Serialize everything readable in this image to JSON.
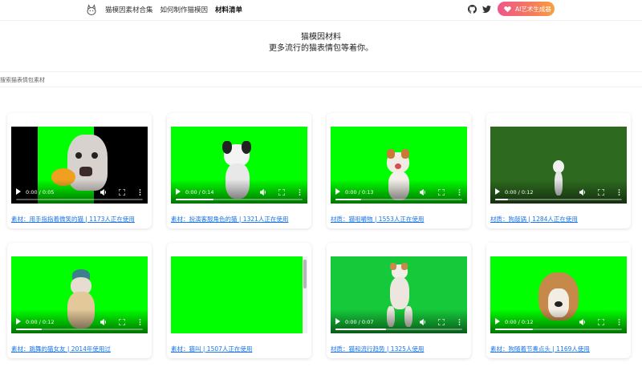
{
  "header": {
    "nav": [
      "猫模因素材合集",
      "如何制作猫模因",
      "材料清单"
    ],
    "active_index": 2,
    "ai_button": "AI艺术生成器",
    "icons": [
      "github-icon",
      "twitter-icon"
    ]
  },
  "hero": {
    "title": "猫模因材料",
    "subtitle": "更多流行的猫表情包等着你。"
  },
  "search": {
    "placeholder": "搜索猫表情包素材"
  },
  "cards": [
    {
      "time": "0:00 / 0:05",
      "caption": "素材：用手指指着微笑的猫 | 1173人正在使用",
      "progress": 0.0
    },
    {
      "time": "0:00 / 0:14",
      "caption": "素材：扮演客服角色的猫 | 1321人正在使用",
      "progress": 0.3
    },
    {
      "time": "0:00 / 0:13",
      "caption": "材质：猫咀嚼物 | 1553人正在使用",
      "progress": 0.2
    },
    {
      "time": "0:00 / 0:12",
      "caption": "材质：狗敲锅 | 1284人正在使用",
      "progress": 0.1
    },
    {
      "time": "0:00 / 0:12",
      "caption": "素材：跳舞的猫女友 | 2014年使用过",
      "progress": 0.2
    },
    {
      "time": "",
      "caption": "素材：猫叫 | 1507人正在使用",
      "progress": 0.0
    },
    {
      "time": "0:00 / 0:07",
      "caption": "材质：猫和流行趋势 | 1325人使用",
      "progress": 0.4
    },
    {
      "time": "0:00 / 0:12",
      "caption": "素材：狗随着节奏点头 | 1169人使用",
      "progress": 0.3
    }
  ],
  "colors": {
    "green_screen": "#00ff00",
    "dark_green": "#2d6a1f",
    "link": "#1a73e8"
  }
}
